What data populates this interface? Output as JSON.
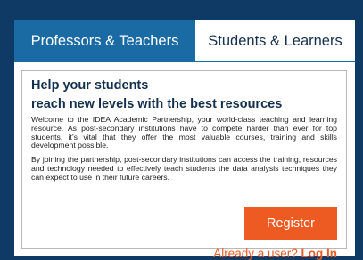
{
  "tabs": [
    {
      "label": "Professors & Teachers",
      "active": true
    },
    {
      "label": "Students & Learners",
      "active": false
    }
  ],
  "content": {
    "heading_line1": "Help your students",
    "heading_line2": "reach new levels with the best resources",
    "paragraph1": "Welcome to the IDEA Academic Partnership, your world-class teaching and learning resource. As post-secondary institutions have to compete harder than ever for top students, it’s vital that they offer the most valuable courses, training and skills development possible.",
    "paragraph2": "By joining the partnership, post-secondary institutions can access the training, resources and technology needed to effectively teach students the data analysis techniques they can expect to use in their future careers.",
    "register_label": "Register",
    "already_user_text": "Already a user?",
    "login_label": "Log In"
  },
  "colors": {
    "background": "#0f3a66",
    "tab_active": "#1a6aa4",
    "heading": "#13304f",
    "accent": "#ee5b22"
  }
}
